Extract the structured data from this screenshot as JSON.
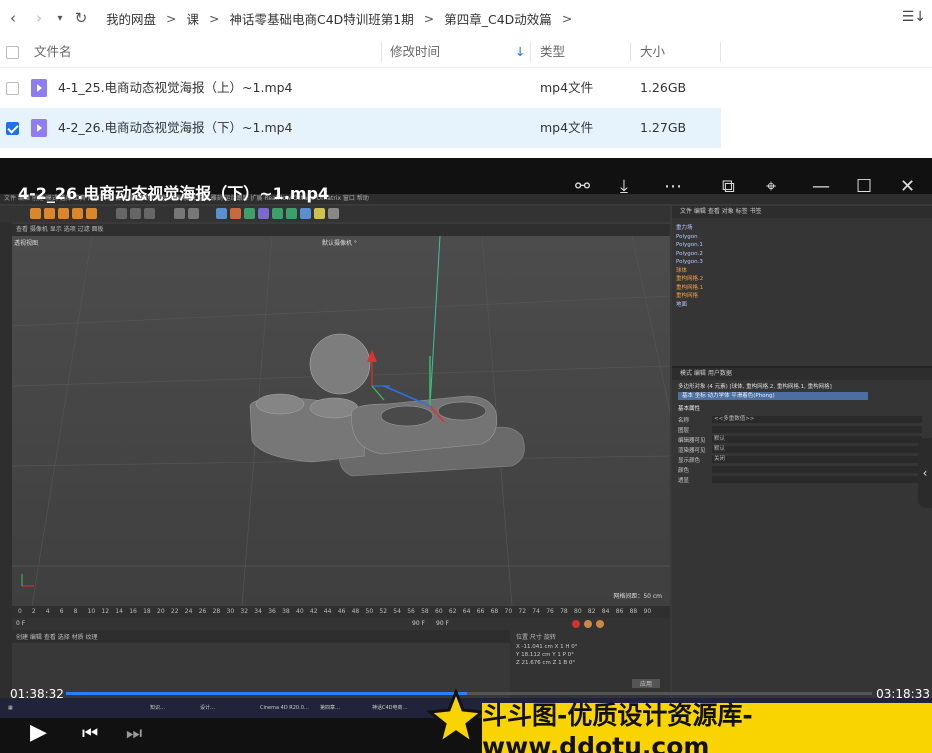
{
  "nav": {
    "back": "‹",
    "forward": "›",
    "dropdown": "▾",
    "refresh": "↻"
  },
  "breadcrumb": [
    "我的网盘",
    "课",
    "神话零基础电商C4D特训班第1期",
    "第四章_C4D动效篇"
  ],
  "breadcrumb_sep": ">",
  "table": {
    "headers": {
      "name": "文件名",
      "modified": "修改时间",
      "type": "类型",
      "size": "大小"
    },
    "rows": [
      {
        "name": "4-1_25.电商动态视觉海报（上）~1.mp4",
        "type": "mp4文件",
        "size": "1.26GB",
        "selected": false
      },
      {
        "name": "4-2_26.电商动态视觉海报（下）~1.mp4",
        "type": "mp4文件",
        "size": "1.27GB",
        "selected": true
      }
    ]
  },
  "player": {
    "title": "4-2_26.电商动态视觉海报（下）~1.mp4",
    "time_current": "01:38:32",
    "time_total": "03:18:33",
    "progress": 0.497
  },
  "c4d": {
    "menu": "文件 编辑 创建 模式 选择 工具 网格 样条 体积 运动图形 角色 动画 模拟 渲染 雕刻 运动跟踪 扩展 RealFlow Octane Ornatrix 窗口 帮助",
    "viewport_label": "透视视图",
    "camera_label": "默认摄像机 °",
    "grid_text": "网格间距：50 cm",
    "right_head": "文件 编辑 查看 对象 标签 书签",
    "objects": [
      {
        "name": "重力场",
        "orange": false
      },
      {
        "name": "Polygon",
        "orange": false
      },
      {
        "name": "Polygon.1",
        "orange": false
      },
      {
        "name": "Polygon.2",
        "orange": false
      },
      {
        "name": "Polygon.3",
        "orange": false
      },
      {
        "name": "球体",
        "orange": true
      },
      {
        "name": "重构网格.2",
        "orange": true
      },
      {
        "name": "重构网格.1",
        "orange": true
      },
      {
        "name": "重构网格",
        "orange": true
      },
      {
        "name": "地面",
        "orange": false
      }
    ],
    "attr_head": "模式 编辑 用户数据",
    "attr_title": "多边形对象 (4 元素) [球体, 重构网格.2, 重构网格.1, 重构网格]",
    "attr_tabs": "基本   坐标   动力学体   平滑着色(Phong)",
    "attr_section": "基本属性",
    "attr_lines": [
      "名称",
      "图层",
      "编辑器可见",
      "渲染器可见",
      "显示颜色",
      "颜色",
      "透显"
    ],
    "attr_values": [
      "<<多重数值>>",
      "",
      "默认",
      "默认",
      "关闭",
      "",
      ""
    ],
    "timeline_numbers": [
      "0",
      "2",
      "4",
      "6",
      "8",
      "10",
      "12",
      "14",
      "16",
      "18",
      "20",
      "22",
      "24",
      "26",
      "28",
      "30",
      "32",
      "34",
      "36",
      "38",
      "40",
      "42",
      "44",
      "46",
      "48",
      "50",
      "52",
      "54",
      "56",
      "58",
      "60",
      "62",
      "64",
      "66",
      "68",
      "70",
      "72",
      "74",
      "76",
      "78",
      "80",
      "82",
      "84",
      "86",
      "88",
      "90"
    ],
    "frame_start": "0 F",
    "frame_end": "90 F",
    "frame_end2": "90 F",
    "bottom_menu": "创建 编辑 查看 选择 材质 纹理",
    "coord_head": "位置          尺寸          旋转",
    "coords": [
      "X -11.041 cm   X 1   H 0°",
      "Y 18.112 cm   Y 1   P 0°",
      "Z 21.676 cm   Z 1   B 0°"
    ],
    "apply": "应用"
  },
  "taskbar": [
    "Cinema 4D R20.0…",
    "设计…",
    "第四章…",
    "知识…",
    "神话C4D电商…"
  ],
  "watermark": "斗斗图-优质设计资源库-www.ddotu.com"
}
